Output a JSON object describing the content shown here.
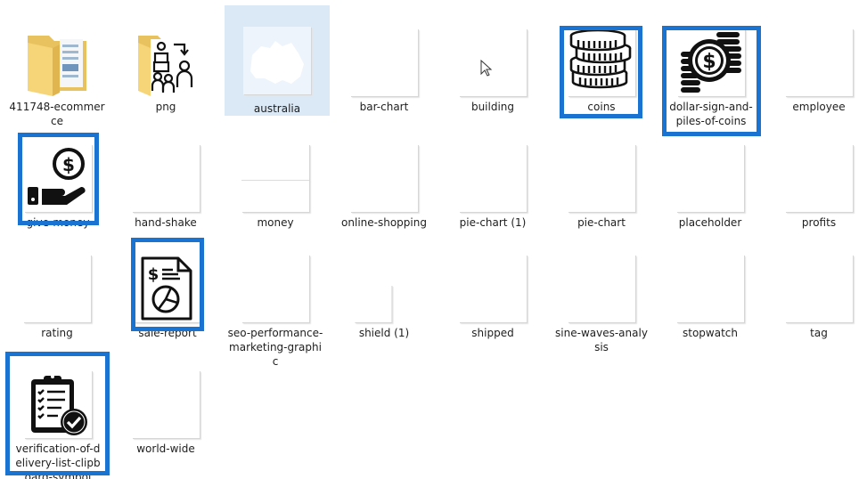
{
  "window": {
    "view": "Large icons",
    "highlight_color": "#1a73d0",
    "selection_color": "#dbe9f7"
  },
  "files": [
    {
      "name": "411748-ecommerce",
      "type": "folder",
      "icon": "folder-with-document-icon"
    },
    {
      "name": "png",
      "type": "folder",
      "icon": "folder-with-people-icon"
    },
    {
      "name": "australia",
      "type": "image",
      "icon": "australia-map-thumbnail",
      "hovered": true
    },
    {
      "name": "bar-chart",
      "type": "image",
      "icon": "blank-thumbnail"
    },
    {
      "name": "building",
      "type": "image",
      "icon": "blank-thumbnail"
    },
    {
      "name": "coins",
      "type": "image",
      "icon": "coins-stack-icon",
      "highlighted": true
    },
    {
      "name": "dollar-sign-and-piles-of-coins",
      "type": "image",
      "icon": "dollar-coin-piles-icon",
      "highlighted": true
    },
    {
      "name": "employee",
      "type": "image",
      "icon": "blank-thumbnail"
    },
    {
      "name": "give-money",
      "type": "image",
      "icon": "hand-giving-money-icon",
      "highlighted": true
    },
    {
      "name": "hand-shake",
      "type": "image",
      "icon": "blank-thumbnail"
    },
    {
      "name": "money",
      "type": "image",
      "icon": "blank-thumbnail"
    },
    {
      "name": "online-shopping",
      "type": "image",
      "icon": "blank-thumbnail"
    },
    {
      "name": "pie-chart (1)",
      "type": "image",
      "icon": "blank-thumbnail"
    },
    {
      "name": "pie-chart",
      "type": "image",
      "icon": "blank-thumbnail"
    },
    {
      "name": "placeholder",
      "type": "image",
      "icon": "blank-thumbnail"
    },
    {
      "name": "profits",
      "type": "image",
      "icon": "blank-thumbnail"
    },
    {
      "name": "rating",
      "type": "image",
      "icon": "blank-thumbnail"
    },
    {
      "name": "sale-report",
      "type": "image",
      "icon": "sale-report-document-icon",
      "highlighted": true
    },
    {
      "name": "seo-performance-marketing-graphic",
      "type": "image",
      "icon": "blank-thumbnail"
    },
    {
      "name": "shield (1)",
      "type": "image",
      "icon": "blank-thumbnail-small"
    },
    {
      "name": "shipped",
      "type": "image",
      "icon": "blank-thumbnail"
    },
    {
      "name": "sine-waves-analysis",
      "type": "image",
      "icon": "blank-thumbnail"
    },
    {
      "name": "stopwatch",
      "type": "image",
      "icon": "blank-thumbnail"
    },
    {
      "name": "tag",
      "type": "image",
      "icon": "blank-thumbnail"
    },
    {
      "name": "verification-of-delivery-list-clipboard-symbol",
      "type": "image",
      "icon": "clipboard-checklist-icon",
      "highlighted": true
    },
    {
      "name": "world-wide",
      "type": "image",
      "icon": "blank-thumbnail"
    }
  ]
}
